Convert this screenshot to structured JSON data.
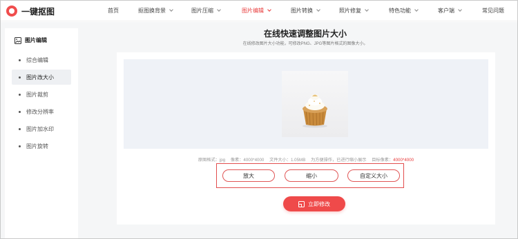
{
  "header": {
    "logo_text": "一键抠图",
    "nav": [
      {
        "label": "首页",
        "dropdown": false,
        "active": false
      },
      {
        "label": "抠图换背景",
        "dropdown": true,
        "active": false
      },
      {
        "label": "图片压缩",
        "dropdown": true,
        "active": false
      },
      {
        "label": "图片编辑",
        "dropdown": true,
        "active": true
      },
      {
        "label": "图片转换",
        "dropdown": true,
        "active": false
      },
      {
        "label": "照片修复",
        "dropdown": true,
        "active": false
      },
      {
        "label": "特色功能",
        "dropdown": true,
        "active": false
      },
      {
        "label": "客户端",
        "dropdown": true,
        "active": false
      },
      {
        "label": "常见问题",
        "dropdown": false,
        "active": false
      }
    ]
  },
  "sidebar": {
    "heading": "图片编辑",
    "items": [
      {
        "label": "综合编辑",
        "active": false
      },
      {
        "label": "图片改大小",
        "active": true
      },
      {
        "label": "图片裁剪",
        "active": false
      },
      {
        "label": "修改分辨率",
        "active": false
      },
      {
        "label": "图片加水印",
        "active": false
      },
      {
        "label": "图片旋转",
        "active": false
      }
    ]
  },
  "main": {
    "title": "在线快速调整图片大小",
    "subtitle": "在线修改图片大小功能，可修改PNG、JPG等图片格式的图像大小。",
    "info": {
      "format": "原图格式：jpg",
      "pixels": "像素：4000*4000",
      "filesize": "文件大小：1.05MB",
      "note": "为方便操作，已进行缩小展示",
      "target_label": "目标像素：",
      "target_value": "4000*4000"
    },
    "buttons": {
      "enlarge": "放大",
      "shrink": "缩小",
      "custom": "自定义大小"
    },
    "cta": "立即修改"
  },
  "colors": {
    "accent": "#e83b3b",
    "cta": "#ef4a4a",
    "preview_bg": "#eff2f7"
  }
}
